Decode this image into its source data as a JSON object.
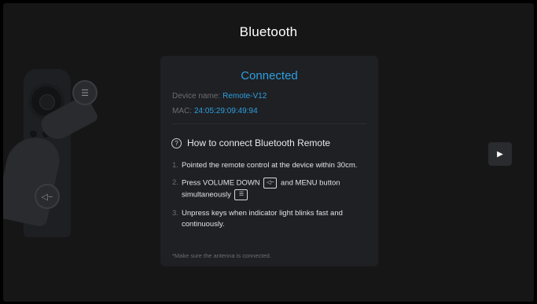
{
  "page": {
    "title": "Bluetooth"
  },
  "card": {
    "status": "Connected",
    "device_name_label": "Device name:",
    "device_name_value": "Remote-V12",
    "mac_label": "MAC:",
    "mac_value": "24:05:29:09:49:94",
    "howto_title": "How to connect Bluetooth Remote",
    "steps": [
      {
        "num": "1.",
        "text": "Pointed the remote control at the device within 30cm."
      },
      {
        "num": "2.",
        "text_a": "Press VOLUME DOWN",
        "key1": "◁−",
        "text_b": "and MENU button simultaneously",
        "key2": "☰"
      },
      {
        "num": "3.",
        "text": "Unpress keys when indicator light blinks fast and continuously."
      }
    ],
    "note": "*Make sure the antenna is connected."
  },
  "icons": {
    "help": "question-circle-icon",
    "next": "play-icon",
    "volume_down_glyph": "◁−",
    "menu_glyph": "☰",
    "play_glyph": "▶"
  },
  "colors": {
    "accent": "#2d9fe0",
    "background": "#161617",
    "card": "#1f2023"
  }
}
